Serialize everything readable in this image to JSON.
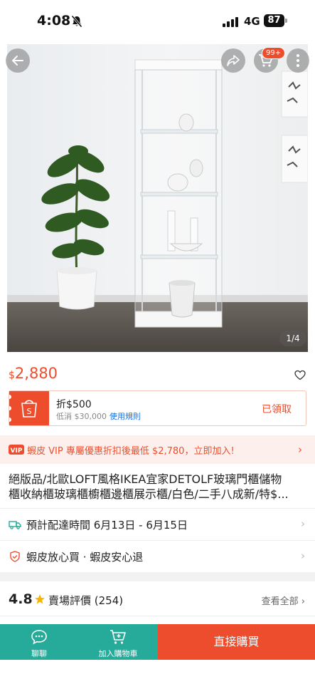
{
  "status_bar": {
    "time": "4:08",
    "network": "4G",
    "battery": "87"
  },
  "gallery": {
    "cart_badge": "99+",
    "counter": "1/4"
  },
  "product": {
    "price_currency": "$",
    "price": "2,880",
    "title_line1": "絕版品/北歐LOFT風格IKEA宜家DETOLF玻璃門櫃儲物",
    "title_line2": "櫃收納櫃玻璃櫃櫥櫃邊櫃展示櫃/白色/二手八成新/特$..."
  },
  "coupon": {
    "title": "折$500",
    "min_spend": "低消 $30,000",
    "rules_link": "使用規則",
    "status": "已領取"
  },
  "vip": {
    "text": "蝦皮 VIP 專屬優惠折扣後最低 $2,780，立即加入!"
  },
  "shipping": {
    "label": "預計配達時間 6月13日 - 6月15日"
  },
  "guarantee": {
    "label": "蝦皮放心買 · 蝦皮安心退"
  },
  "rating": {
    "score": "4.8",
    "label": "賣場評價 (254)",
    "view_all": "查看全部"
  },
  "bottom_bar": {
    "chat_label": "聊聊",
    "add_cart_label": "加入購物車",
    "buy_now_label": "直接購買"
  },
  "colors": {
    "accent": "#ee4d2d",
    "teal": "#26aa99",
    "link": "#1e6fd9"
  }
}
